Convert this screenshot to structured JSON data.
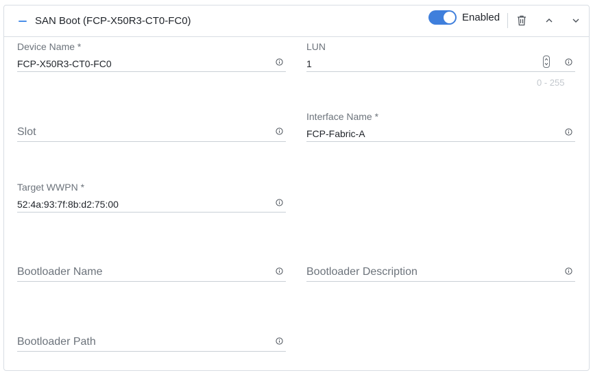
{
  "header": {
    "title": "SAN Boot (FCP-X50R3-CT0-FC0)",
    "toggle_label": "Enabled",
    "toggle_on": true
  },
  "fields": {
    "device_name": {
      "label": "Device Name *",
      "value": "FCP-X50R3-CT0-FC0"
    },
    "lun": {
      "label": "LUN",
      "value": "1",
      "range_hint": "0 - 255"
    },
    "slot": {
      "placeholder": "Slot"
    },
    "interface_name": {
      "label": "Interface Name *",
      "value": "FCP-Fabric-A"
    },
    "target_wwpn": {
      "label": "Target WWPN *",
      "value": "52:4a:93:7f:8b:d2:75:00"
    },
    "bootloader_name": {
      "placeholder": "Bootloader Name"
    },
    "bootloader_description": {
      "placeholder": "Bootloader Description"
    },
    "bootloader_path": {
      "placeholder": "Bootloader Path"
    }
  },
  "icons": {
    "collapse": "minus-icon",
    "delete": "trash-icon",
    "move_up": "chevron-up-icon",
    "expand": "chevron-down-icon",
    "info": "info-icon"
  },
  "colors": {
    "accent": "#3f7fdc",
    "border": "#d8dde3",
    "label": "#6c737b",
    "text": "#1f2329"
  }
}
